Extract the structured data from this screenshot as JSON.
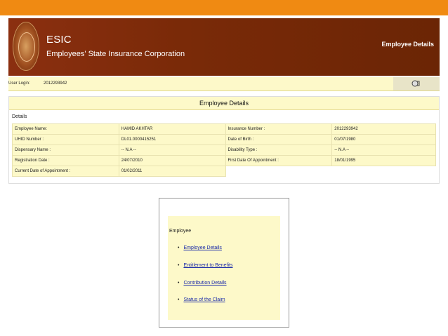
{
  "header": {
    "brand": "ESIC",
    "corporation": "Employees' State Insurance Corporation",
    "page_title": "Employee Details",
    "logo_icon": "esic-emblem-icon"
  },
  "login": {
    "label": "User Login:",
    "value": "2012293942",
    "logout_icon": "logout-icon"
  },
  "panel": {
    "title": "Employee Details",
    "section_label": "Details",
    "rows": [
      {
        "l1": "Employee Name:",
        "v1": "HAMID AKHTAR",
        "l2": "Insurance Number :",
        "v2": "2012293942"
      },
      {
        "l1": "UHID Number :",
        "v1": "DL01.0000415251",
        "l2": "Date of Birth :",
        "v2": "01/07/1980"
      },
      {
        "l1": "Dispensary Name :",
        "v1": "-- N.A --",
        "l2": "Disability Type :",
        "v2": "-- N.A --"
      },
      {
        "l1": "Registration Date :",
        "v1": "24/07/2010",
        "l2": "First Date Of Appointment :",
        "v2": "18/01/1995"
      },
      {
        "l1": "Current Date of Appointment :",
        "v1": "01/02/2011",
        "l2": "",
        "v2": ""
      }
    ]
  },
  "menu": {
    "title": "Employee",
    "items": [
      {
        "label": "Employee Details"
      },
      {
        "label": "Entitlement to Benefits"
      },
      {
        "label": "Contribution Details"
      },
      {
        "label": "Status of the Claim"
      }
    ],
    "bullet": "•"
  },
  "colors": {
    "top_bar": "#f08a12",
    "header_bg": "#7a2a08",
    "panel_bg": "#fdf9c9",
    "link": "#1a2aa8"
  }
}
